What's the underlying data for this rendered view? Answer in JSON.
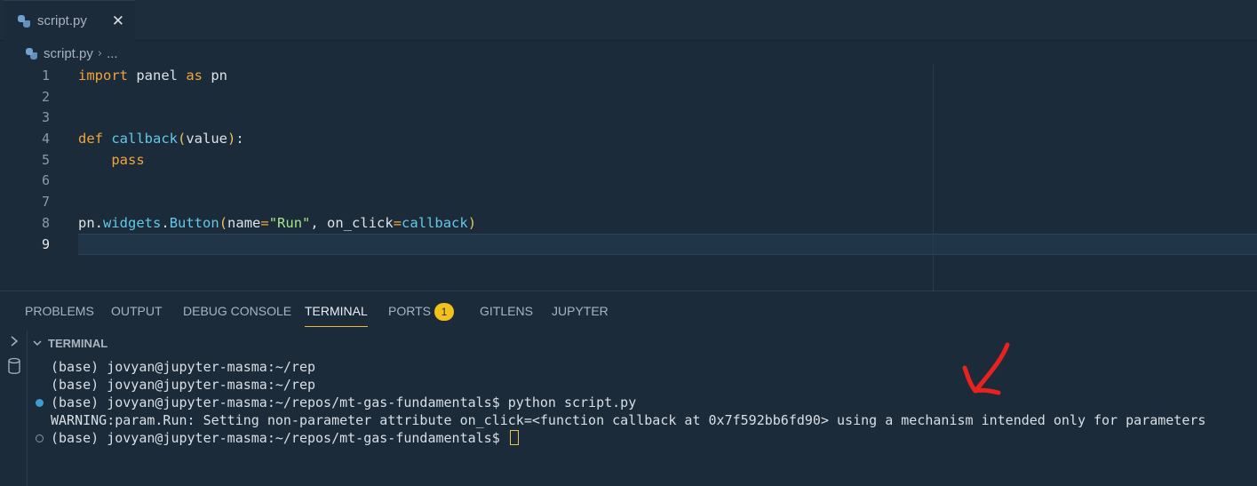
{
  "tab": {
    "label": "script.py",
    "close": "✕"
  },
  "breadcrumb": {
    "file": "script.py",
    "separator": "›",
    "rest": "..."
  },
  "editor": {
    "line_numbers": [
      "1",
      "2",
      "3",
      "4",
      "5",
      "6",
      "7",
      "8",
      "9"
    ],
    "active_line": "9"
  },
  "code": {
    "l1": {
      "kw1": "import",
      "mod": " panel ",
      "kw2": "as",
      "alias": " pn"
    },
    "l4": {
      "kw": "def",
      "name": " callback",
      "open": "(",
      "param": "value",
      "close": ")",
      "colon": ":"
    },
    "l5": {
      "indent": "    ",
      "kw": "pass"
    },
    "l8": {
      "obj": "pn",
      "dot1": ".",
      "attr": "widgets",
      "dot2": ".",
      "cls": "Button",
      "open": "(",
      "kw1": "name",
      "eq1": "=",
      "str": "\"Run\"",
      "comma": ", ",
      "kw2": "on_click",
      "eq2": "=",
      "val": "callback",
      "close": ")"
    }
  },
  "panel": {
    "tabs": [
      {
        "label": "PROBLEMS"
      },
      {
        "label": "OUTPUT"
      },
      {
        "label": "DEBUG CONSOLE"
      },
      {
        "label": "TERMINAL"
      },
      {
        "label": "PORTS"
      },
      {
        "label": "GITLENS"
      },
      {
        "label": "JUPYTER"
      }
    ],
    "ports_badge": "1",
    "terminal_title": "TERMINAL"
  },
  "terminal": {
    "lines": [
      "(base) jovyan@jupyter-masma:~/rep",
      "(base) jovyan@jupyter-masma:~/rep",
      "(base) jovyan@jupyter-masma:~/repos/mt-gas-fundamentals$ python script.py",
      "WARNING:param.Run: Setting non-parameter attribute on_click=<function callback at 0x7f592bb6fd90> using a mechanism intended only for parameters",
      "(base) jovyan@jupyter-masma:~/repos/mt-gas-fundamentals$ "
    ]
  },
  "colors": {
    "accent": "#f0b43a",
    "annotation": "#e8221f",
    "background": "#1b2b3a"
  }
}
